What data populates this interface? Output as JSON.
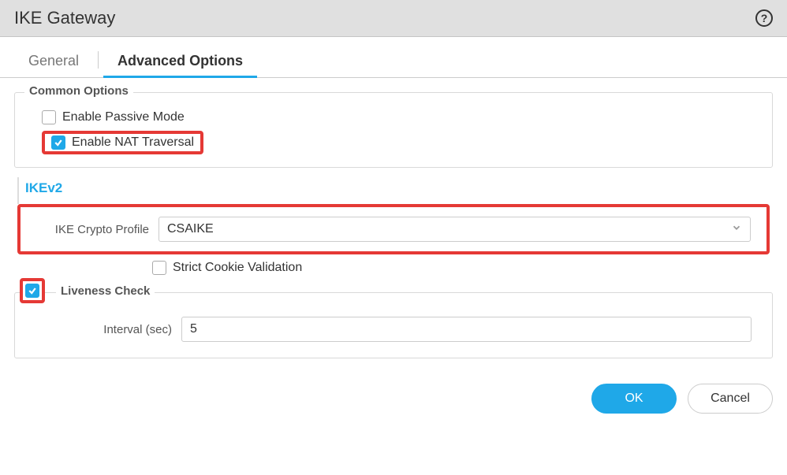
{
  "header": {
    "title": "IKE Gateway",
    "help_label": "?"
  },
  "tabs": {
    "general": "General",
    "advanced": "Advanced Options"
  },
  "common_options": {
    "legend": "Common Options",
    "passive_mode": {
      "label": "Enable Passive Mode",
      "checked": false
    },
    "nat_traversal": {
      "label": "Enable NAT Traversal",
      "checked": true
    }
  },
  "ikev2": {
    "header": "IKEv2",
    "crypto_profile": {
      "label": "IKE Crypto Profile",
      "value": "CSAIKE"
    },
    "strict_cookie": {
      "label": "Strict Cookie Validation",
      "checked": false
    }
  },
  "liveness": {
    "legend": "Liveness Check",
    "checked": true,
    "interval": {
      "label": "Interval (sec)",
      "value": "5"
    }
  },
  "buttons": {
    "ok": "OK",
    "cancel": "Cancel"
  }
}
